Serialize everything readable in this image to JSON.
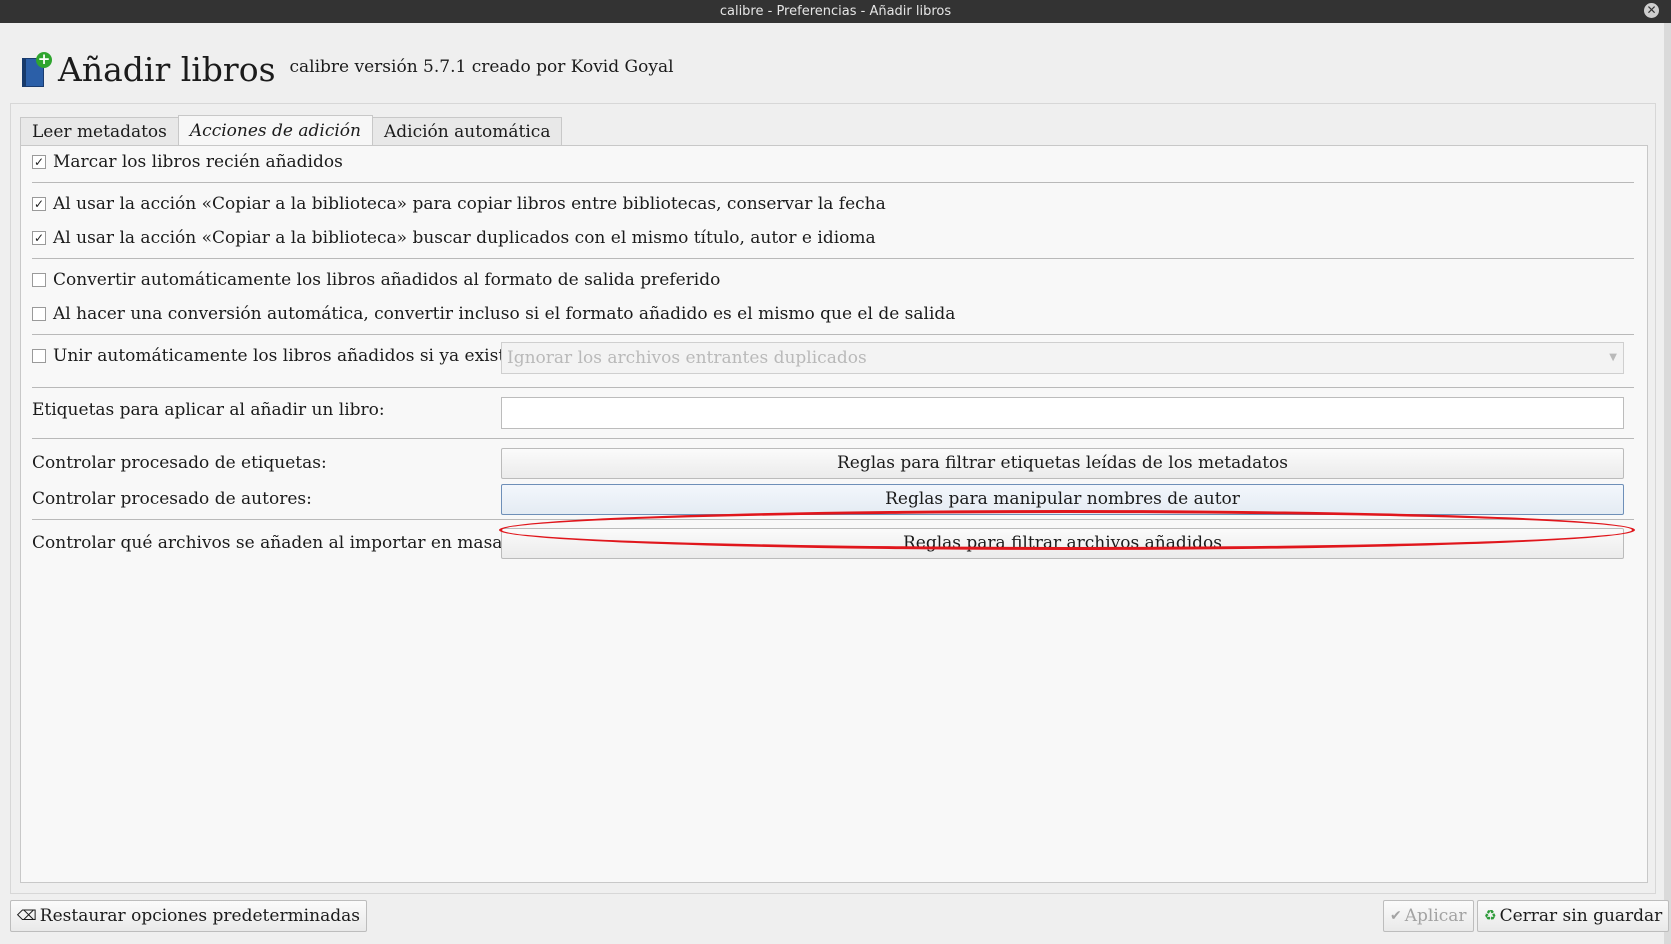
{
  "window": {
    "title": "calibre - Preferencias - Añadir libros"
  },
  "header": {
    "title": "Añadir libros",
    "version": "calibre versión 5.7.1 creado por Kovid Goyal"
  },
  "tabs": [
    {
      "label": "Leer metadatos",
      "active": false
    },
    {
      "label": "Acciones de adición",
      "active": true
    },
    {
      "label": "Adición automática",
      "active": false
    }
  ],
  "options": {
    "mark_new": {
      "label": "Marcar los libros recién añadidos",
      "checked": true
    },
    "preserve_date": {
      "label": "Al usar la acción «Copiar a la  biblioteca» para copiar libros entre bibliotecas, conservar la fecha",
      "checked": true
    },
    "check_duplicates": {
      "label": "Al usar la acción «Copiar a la biblioteca» buscar duplicados con el mismo título, autor e idioma",
      "checked": true
    },
    "auto_convert": {
      "label": "Convertir automáticamente los libros añadidos al formato de salida preferido",
      "checked": false
    },
    "convert_same": {
      "label": "Al hacer una conversión automática, convertir incluso si el formato añadido es el mismo que el de salida",
      "checked": false
    },
    "auto_merge": {
      "label": "Unir automáticamente los libros añadidos si ya existen:",
      "checked": false
    }
  },
  "merge_combo": {
    "value": "Ignorar los archivos entrantes duplicados",
    "enabled": false
  },
  "tags": {
    "label": "Etiquetas para aplicar al añadir un libro:",
    "value": ""
  },
  "rules": {
    "tags_label": "Controlar procesado de etiquetas:",
    "tags_button": "Reglas para filtrar etiquetas leídas de los metadatos",
    "authors_label": "Controlar procesado de autores:",
    "authors_button": "Reglas para manipular nombres de autor",
    "files_label": "Controlar qué archivos se añaden al importar en masa:",
    "files_button": "Reglas para filtrar archivos añadidos"
  },
  "footer": {
    "restore": "Restaurar opciones predeterminadas",
    "apply": "Aplicar",
    "close": "Cerrar sin guardar"
  },
  "colors": {
    "highlight": "#e0161c",
    "titlebar": "#333333"
  },
  "icons": {
    "app": "add-book-icon",
    "restore": "restore-icon",
    "apply": "checkmark-icon",
    "close": "recycle-icon"
  }
}
